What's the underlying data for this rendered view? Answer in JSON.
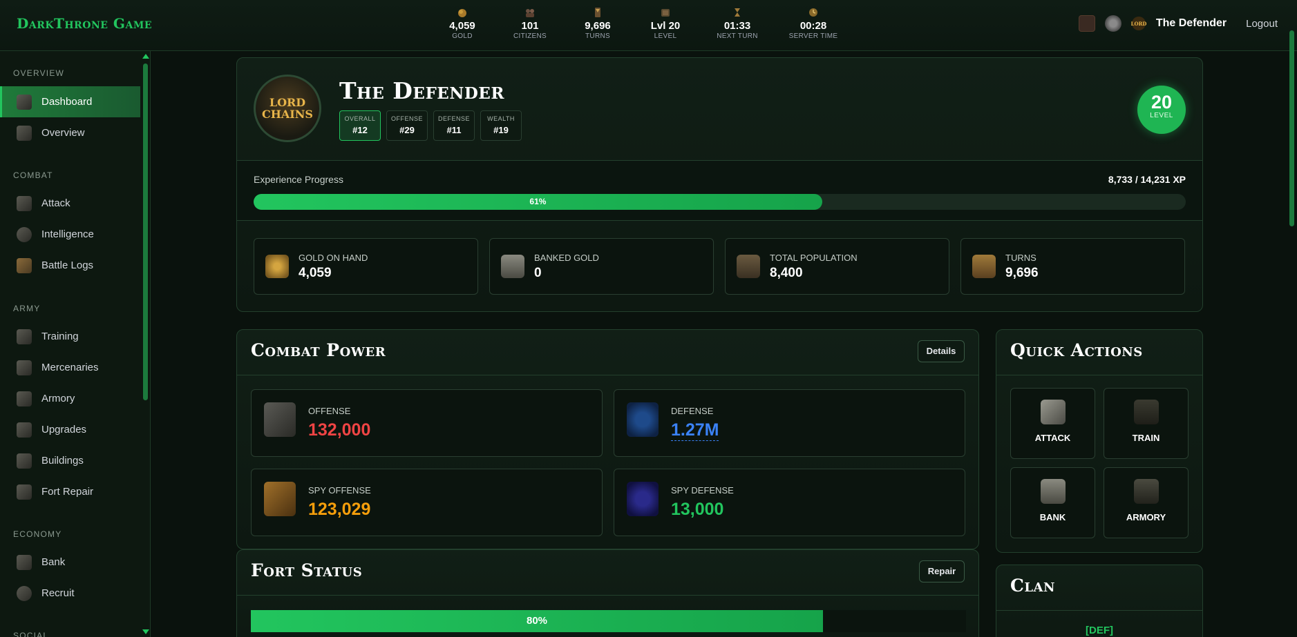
{
  "brand": "DarkThrone Game",
  "stats": [
    {
      "icon": "gold-coins-icon",
      "value": "4,059",
      "label": "GOLD"
    },
    {
      "icon": "citizens-icon",
      "value": "101",
      "label": "CITIZENS"
    },
    {
      "icon": "turns-icon",
      "value": "9,696",
      "label": "TURNS"
    },
    {
      "icon": "level-icon",
      "value": "Lvl 20",
      "label": "LEVEL"
    },
    {
      "icon": "hourglass-icon",
      "value": "01:33",
      "label": "NEXT TURN"
    },
    {
      "icon": "clock-icon",
      "value": "00:28",
      "label": "SERVER TIME"
    }
  ],
  "user": {
    "name": "The Defender",
    "logout": "Logout"
  },
  "sidebar": {
    "sections": [
      {
        "title": "OVERVIEW",
        "items": [
          {
            "label": "Dashboard",
            "active": true
          },
          {
            "label": "Overview"
          }
        ]
      },
      {
        "title": "COMBAT",
        "items": [
          {
            "label": "Attack"
          },
          {
            "label": "Intelligence"
          },
          {
            "label": "Battle Logs"
          }
        ]
      },
      {
        "title": "ARMY",
        "items": [
          {
            "label": "Training"
          },
          {
            "label": "Mercenaries"
          },
          {
            "label": "Armory"
          },
          {
            "label": "Upgrades"
          },
          {
            "label": "Buildings"
          },
          {
            "label": "Fort Repair"
          }
        ]
      },
      {
        "title": "ECONOMY",
        "items": [
          {
            "label": "Bank"
          },
          {
            "label": "Recruit"
          }
        ]
      },
      {
        "title": "SOCIAL",
        "items": []
      }
    ]
  },
  "profile": {
    "avatar_text": [
      "LORD",
      "CHAINS"
    ],
    "name": "The Defender",
    "ranks": [
      {
        "label": "OVERALL",
        "value": "#12"
      },
      {
        "label": "OFFENSE",
        "value": "#29"
      },
      {
        "label": "DEFENSE",
        "value": "#11"
      },
      {
        "label": "WEALTH",
        "value": "#19"
      }
    ],
    "level": "20",
    "level_label": "LEVEL"
  },
  "xp": {
    "label": "Experience Progress",
    "value": "8,733 / 14,231 XP",
    "percent": 61,
    "percent_text": "61%"
  },
  "resources": [
    {
      "icon": "gold-pile-icon",
      "label": "GOLD ON HAND",
      "value": "4,059",
      "color": "#b8862b"
    },
    {
      "icon": "bank-icon",
      "label": "BANKED GOLD",
      "value": "0",
      "color": "#6b6b60"
    },
    {
      "icon": "population-icon",
      "label": "TOTAL POPULATION",
      "value": "8,400",
      "color": "#5a5040"
    },
    {
      "icon": "hourglass-icon",
      "label": "TURNS",
      "value": "9,696",
      "color": "#8a6a30"
    }
  ],
  "combat": {
    "title": "Combat Power",
    "details": "Details",
    "items": [
      {
        "icon": "sword-shield-icon",
        "label": "OFFENSE",
        "value": "132,000",
        "color": "#ef4444"
      },
      {
        "icon": "shield-icon",
        "label": "DEFENSE",
        "value": "1.27M",
        "color": "#3b82f6"
      },
      {
        "icon": "spy-icon",
        "label": "SPY OFFENSE",
        "value": "123,029",
        "color": "#f59e0b"
      },
      {
        "icon": "hooded-figure-icon",
        "label": "SPY DEFENSE",
        "value": "13,000",
        "color": "#22c55e"
      }
    ]
  },
  "quick": {
    "title": "Quick Actions",
    "actions": [
      {
        "label": "ATTACK"
      },
      {
        "label": "TRAIN"
      },
      {
        "label": "BANK"
      },
      {
        "label": "ARMORY"
      }
    ]
  },
  "fort": {
    "title": "Fort Status",
    "repair": "Repair",
    "percent": 80,
    "percent_text": "80%"
  },
  "clan": {
    "title": "Clan",
    "tag": "[DEF]"
  }
}
